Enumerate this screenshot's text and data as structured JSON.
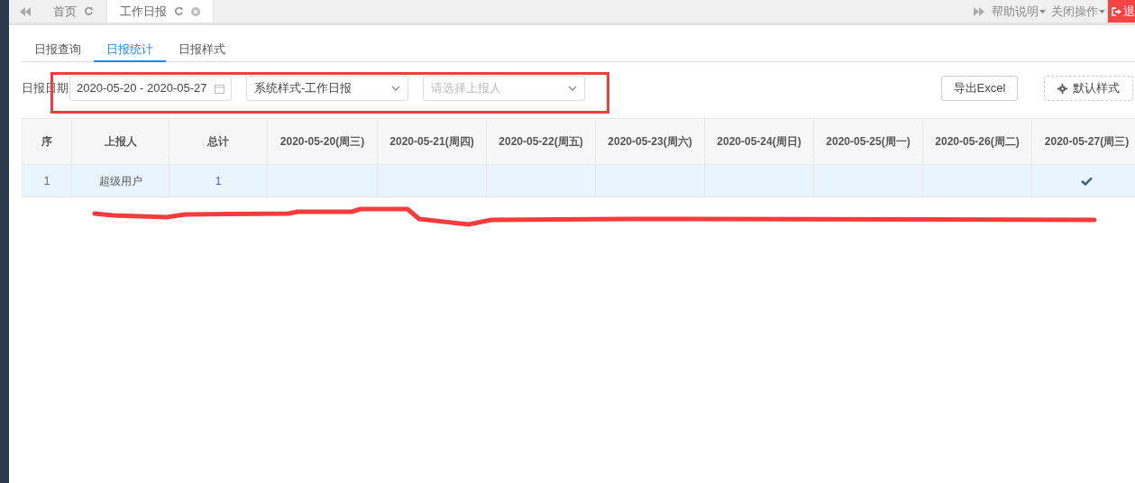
{
  "top_tabs": [
    {
      "label": "首页",
      "selected": false,
      "closable": false
    },
    {
      "label": "工作日报",
      "selected": true,
      "closable": true
    }
  ],
  "top_menu": [
    "帮助说明",
    "关闭操作"
  ],
  "logout_button": "退",
  "sub_tabs": [
    {
      "label": "日报查询",
      "selected": false
    },
    {
      "label": "日报统计",
      "selected": true
    },
    {
      "label": "日报样式",
      "selected": false
    }
  ],
  "filters": {
    "date_label": "日报日期",
    "date_range": "2020-05-20 - 2020-05-27",
    "style_select": "系统样式-工作日报",
    "reporter_select": {
      "placeholder": "请选择上报人"
    }
  },
  "buttons": {
    "export": "导出Excel",
    "default_style": "默认样式"
  },
  "table": {
    "columns": [
      "序",
      "上报人",
      "总计",
      "2020-05-20(周三)",
      "2020-05-21(周四)",
      "2020-05-22(周五)",
      "2020-05-23(周六)",
      "2020-05-24(周日)",
      "2020-05-25(周一)",
      "2020-05-26(周二)",
      "2020-05-27(周三)"
    ],
    "rows": [
      {
        "index": "1",
        "reporter": "超级用户",
        "total": "1",
        "days": [
          {
            "checked": false
          },
          {
            "checked": false
          },
          {
            "checked": false
          },
          {
            "checked": false
          },
          {
            "checked": false
          },
          {
            "checked": false
          },
          {
            "checked": false
          },
          {
            "checked": true
          }
        ]
      }
    ]
  }
}
